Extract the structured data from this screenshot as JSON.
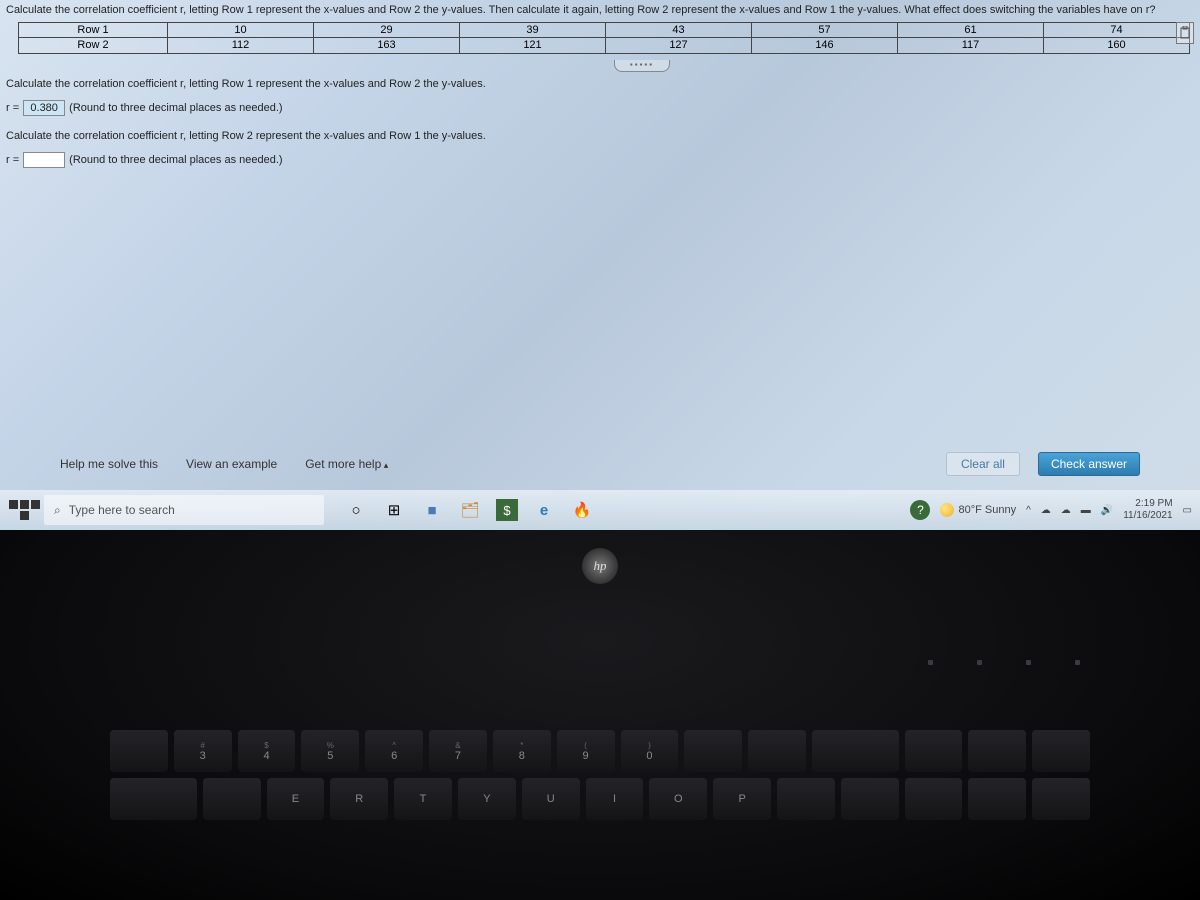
{
  "question": {
    "prompt": "Calculate the correlation coefficient r, letting Row 1 represent the x-values and Row 2 the y-values. Then calculate it again, letting Row 2 represent the x-values and Row 1 the y-values. What effect does switching the variables have on r?",
    "table": {
      "rows": [
        {
          "label": "Row 1",
          "values": [
            "10",
            "29",
            "39",
            "43",
            "57",
            "61",
            "74"
          ]
        },
        {
          "label": "Row 2",
          "values": [
            "112",
            "163",
            "121",
            "127",
            "146",
            "117",
            "160"
          ]
        }
      ]
    }
  },
  "body": {
    "part1_instruction": "Calculate the correlation coefficient r, letting Row 1 represent the x-values and Row 2 the y-values.",
    "part1_prefix": "r =",
    "part1_value": "0.380",
    "part1_suffix": "(Round to three decimal places as needed.)",
    "part2_instruction": "Calculate the correlation coefficient r, letting Row 2 represent the x-values and Row 1 the y-values.",
    "part2_prefix": "r =",
    "part2_value": "",
    "part2_suffix": "(Round to three decimal places as needed.)"
  },
  "helpbar": {
    "solve": "Help me solve this",
    "example": "View an example",
    "more": "Get more help",
    "clear": "Clear all",
    "check": "Check answer"
  },
  "taskbar": {
    "search_placeholder": "Type here to search",
    "weather": "80°F Sunny",
    "time": "2:19 PM",
    "date": "11/16/2021"
  },
  "icons": {
    "search": "⌕",
    "cortana": "○",
    "taskview": "⊞",
    "store": "🛍",
    "app1": "■",
    "app2": "🗂",
    "dollar": "$",
    "edge": "e",
    "firefox": "🔥",
    "help": "?",
    "caret": "^",
    "onedrive": "☁",
    "battery": "▬",
    "volume": "🔊",
    "notif": "▭",
    "hp": "hp",
    "expand": "▪▪▪▪▪"
  }
}
